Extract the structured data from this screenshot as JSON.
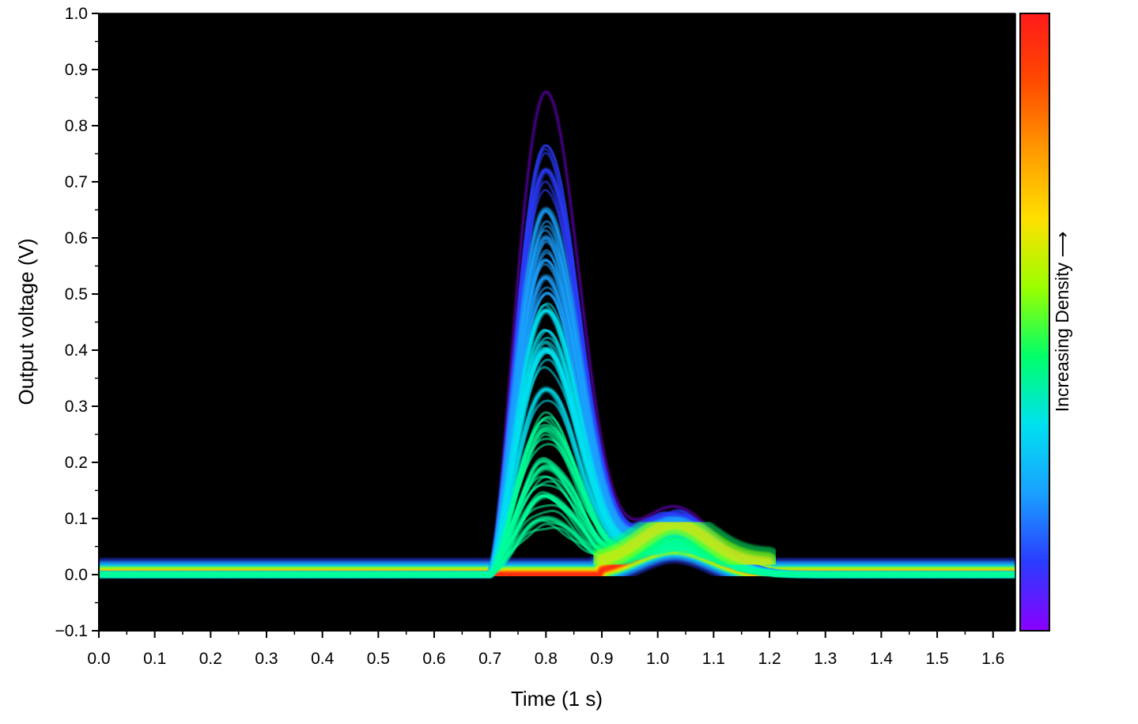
{
  "chart_data": {
    "type": "heatmap",
    "title": "",
    "xlabel": "Time (1 s)",
    "ylabel": "Output voltage (V)",
    "xlim": [
      0.0,
      1.64
    ],
    "ylim": [
      -0.1,
      1.0
    ],
    "x_ticks": [
      "0.0",
      "0.1",
      "0.2",
      "0.3",
      "0.4",
      "0.5",
      "0.6",
      "0.7",
      "0.8",
      "0.9",
      "1.0",
      "1.1",
      "1.2",
      "1.3",
      "1.4",
      "1.5",
      "1.6"
    ],
    "x_tick_values": [
      0.0,
      0.1,
      0.2,
      0.3,
      0.4,
      0.5,
      0.6,
      0.7,
      0.8,
      0.9,
      1.0,
      1.1,
      1.2,
      1.3,
      1.4,
      1.5,
      1.6
    ],
    "y_ticks": [
      "−0.1",
      "0.0",
      "0.1",
      "0.2",
      "0.3",
      "0.4",
      "0.5",
      "0.6",
      "0.7",
      "0.8",
      "0.9",
      "1.0"
    ],
    "y_tick_values": [
      -0.1,
      0.0,
      0.1,
      0.2,
      0.3,
      0.4,
      0.5,
      0.6,
      0.7,
      0.8,
      0.9,
      1.0
    ],
    "plot_background": "#000000",
    "grid": false,
    "colorbar": {
      "label": "Increasing Density ⟶",
      "colors": [
        "#8a00ff",
        "#2a3cff",
        "#1aa0ff",
        "#00e0f0",
        "#00ff6a",
        "#9aff00",
        "#ffe000",
        "#ff9a00",
        "#ff4a00",
        "#ff1a1a"
      ]
    },
    "pulse_amplitudes": [
      0.86,
      0.72,
      0.65,
      0.6,
      0.53,
      0.47,
      0.4,
      0.33,
      0.26,
      0.19,
      0.14,
      0.1
    ],
    "pulse_peak_time": 0.8,
    "pulse_start_time": 0.7,
    "secondary_bump_time": 1.03,
    "secondary_bump_amplitude": 0.1,
    "baseline_voltage": 0.0
  }
}
